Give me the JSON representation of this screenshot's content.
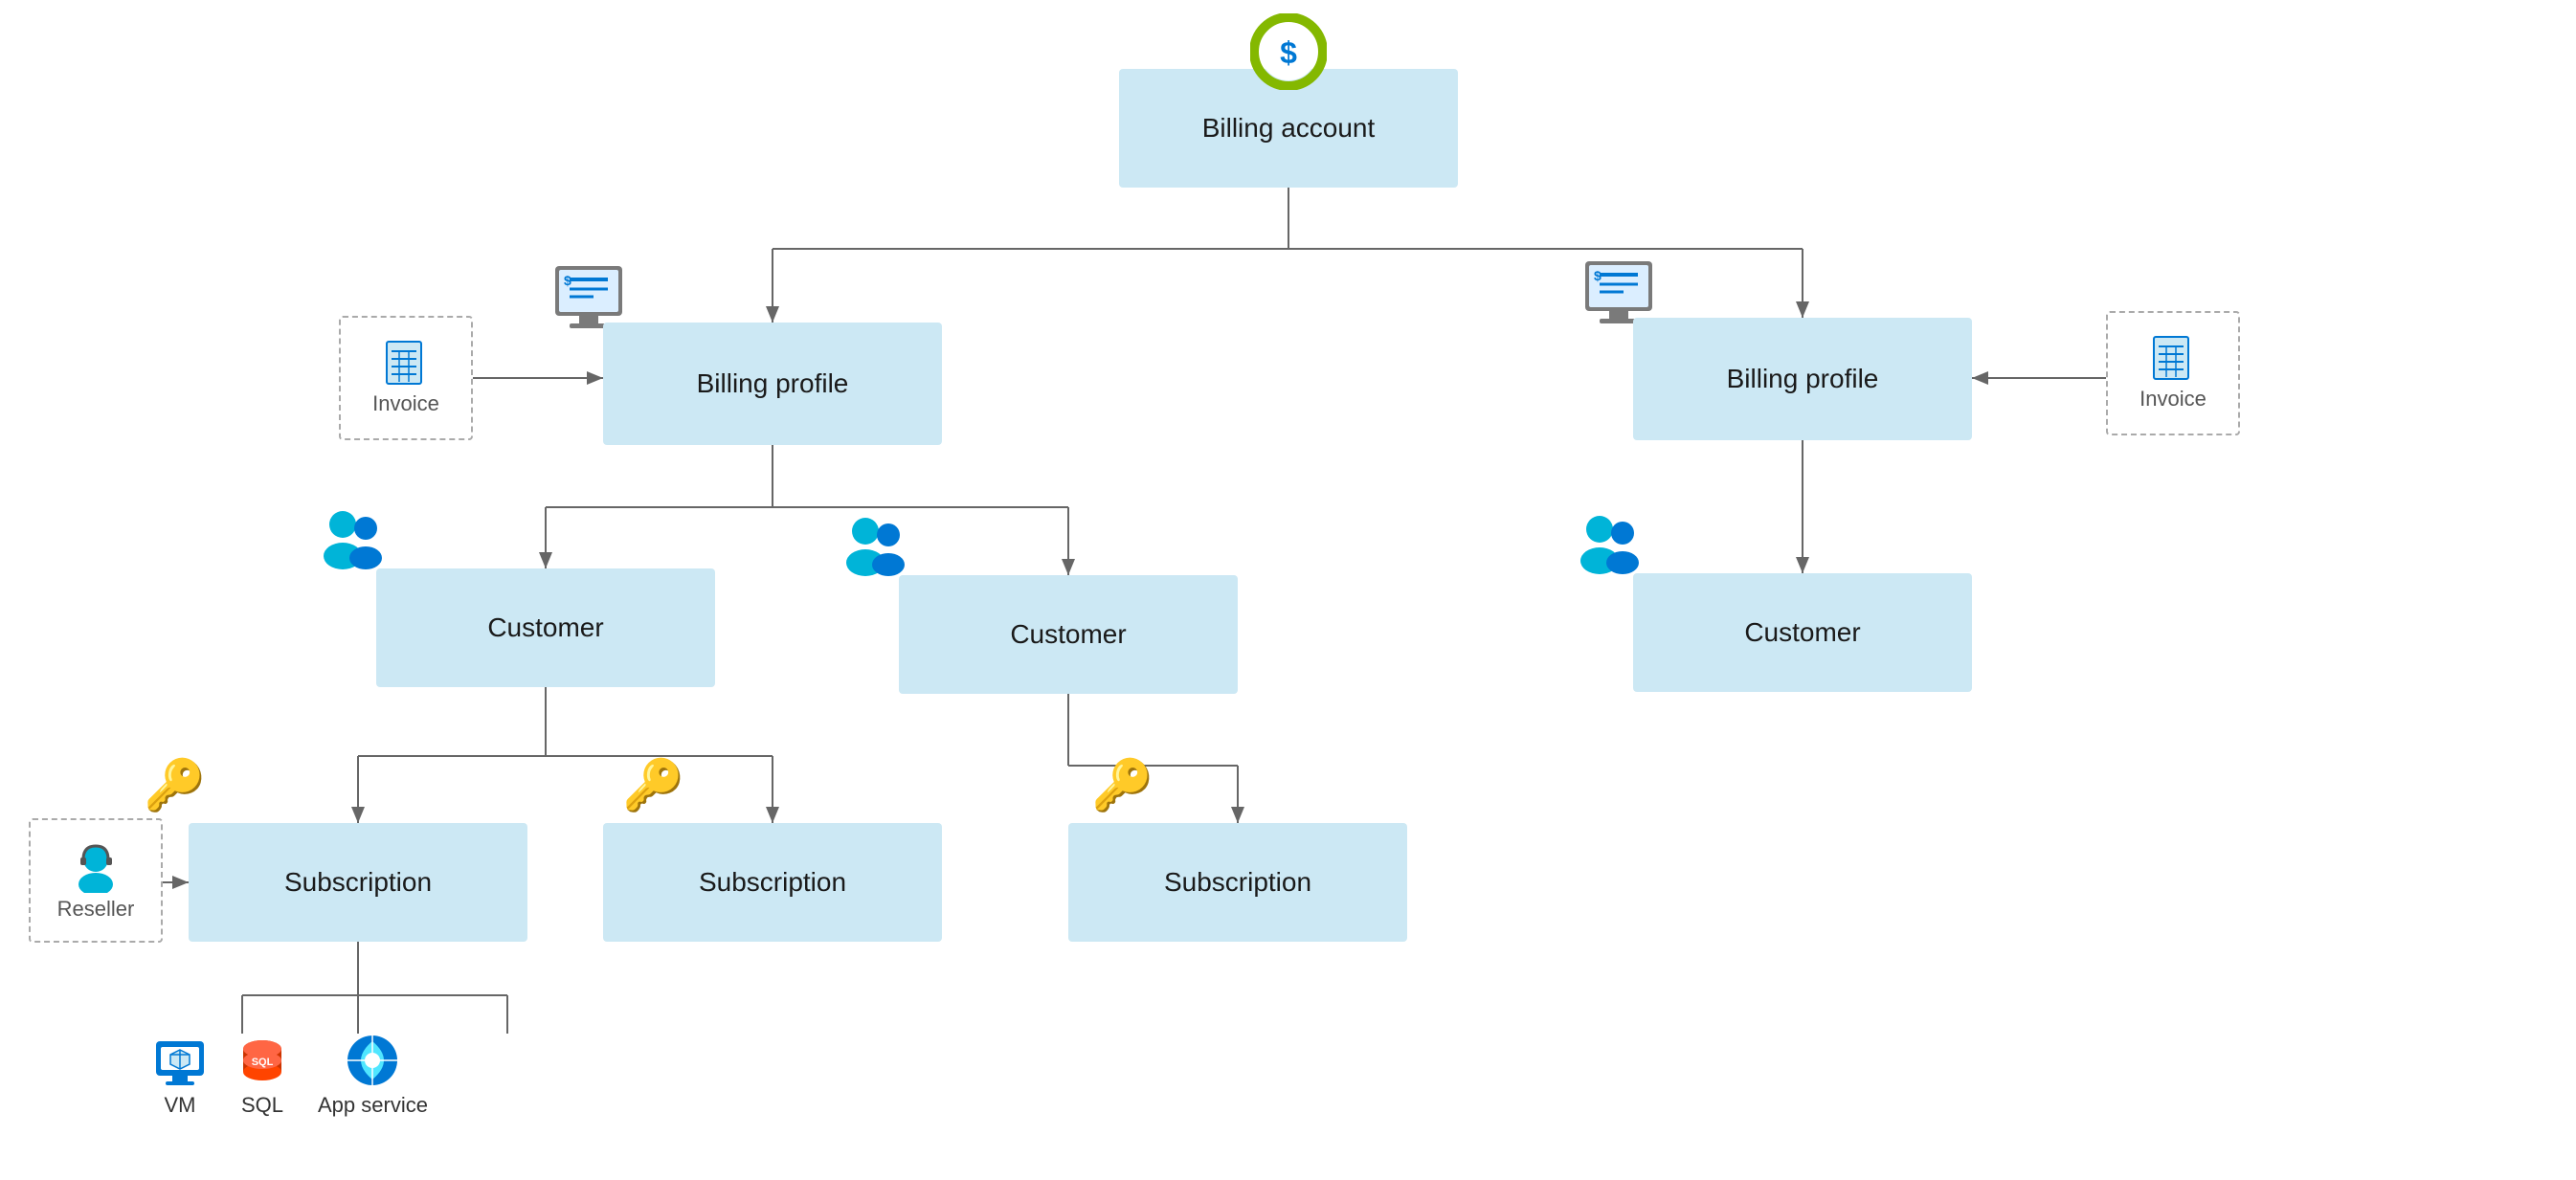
{
  "nodes": {
    "billing_account": {
      "label": "Billing account"
    },
    "billing_profile_left": {
      "label": "Billing profile"
    },
    "billing_profile_right": {
      "label": "Billing profile"
    },
    "customer_1": {
      "label": "Customer"
    },
    "customer_2": {
      "label": "Customer"
    },
    "customer_3": {
      "label": "Customer"
    },
    "subscription_1": {
      "label": "Subscription"
    },
    "subscription_2": {
      "label": "Subscription"
    },
    "subscription_3": {
      "label": "Subscription"
    }
  },
  "dashed": {
    "invoice_left": {
      "label": "Invoice"
    },
    "invoice_right": {
      "label": "Invoice"
    },
    "reseller": {
      "label": "Reseller"
    }
  },
  "resources": {
    "vm": {
      "label": "VM"
    },
    "sql": {
      "label": "SQL"
    },
    "app_service": {
      "label": "App service"
    }
  }
}
